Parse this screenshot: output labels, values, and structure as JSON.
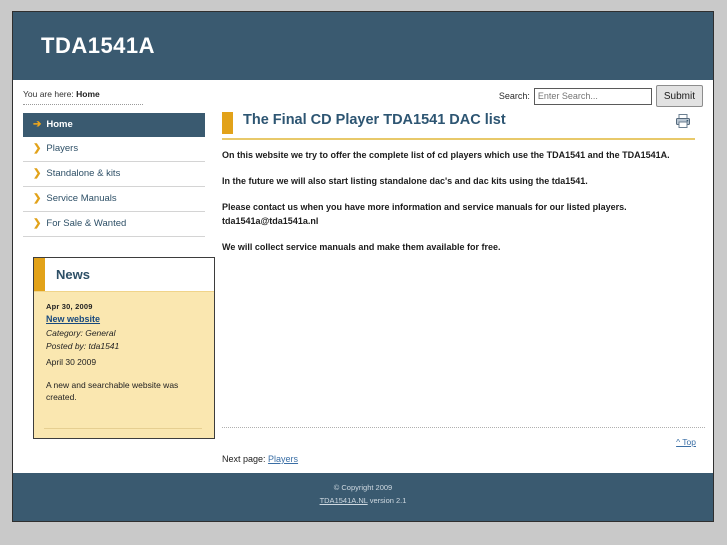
{
  "site": {
    "banner_title": "TDA1541A",
    "accent_color": "#e2a219",
    "header_color": "#3a5a70",
    "link_color": "#3a6ea5"
  },
  "utility": {
    "breadcrumb_label": "You are here:",
    "breadcrumb_current": "Home",
    "search_label": "Search:",
    "search_value": "",
    "search_placeholder": "Enter Search...",
    "submit_label": "Submit"
  },
  "sidebar": {
    "nav": [
      {
        "label": "Home",
        "arrow": "➔",
        "active": true
      },
      {
        "label": "Players",
        "arrow": "❯",
        "active": false
      },
      {
        "label": "Standalone & kits",
        "arrow": "❯",
        "active": false
      },
      {
        "label": "Service Manuals",
        "arrow": "❯",
        "active": false
      },
      {
        "label": "For Sale & Wanted",
        "arrow": "❯",
        "active": false
      }
    ],
    "news": {
      "title": "News",
      "date": "Apr 30, 2009",
      "headline": "New website",
      "category": "Category: General",
      "posted_by": "Posted by: tda1541",
      "posted_date": "April 30 2009",
      "body": "A new and searchable website was created."
    }
  },
  "main": {
    "title": "The Final CD Player TDA1541 DAC list",
    "print_icon": "printer-icon",
    "paragraphs": [
      "On this website we try to offer the complete list of cd players which use the TDA1541 and the TDA1541A.",
      "In the future we will also start listing standalone dac's and dac kits using the tda1541.",
      "Please contact us when you have more information and service manuals for our listed players. tda1541a@tda1541a.nl",
      "We will collect service manuals and make them available for free."
    ],
    "top_link": "^ Top",
    "next_page_label": "Next page:",
    "next_page_link": "Players"
  },
  "footer": {
    "copyright": "© Copyright 2009",
    "site_link": "TDA1541A.NL",
    "version": " version 2.1"
  }
}
